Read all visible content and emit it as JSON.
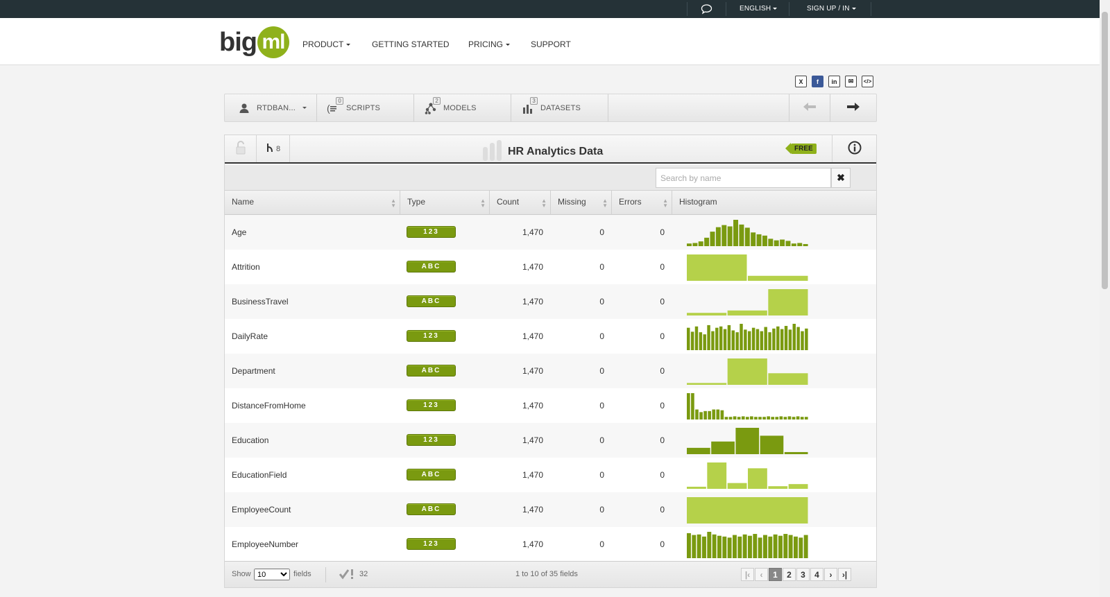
{
  "topbar": {
    "language": "ENGLISH",
    "signup": "SIGN UP / IN"
  },
  "logo": {
    "part1": "big",
    "part2": "ml"
  },
  "nav": {
    "product": "PRODUCT",
    "getting_started": "GETTING STARTED",
    "pricing": "PRICING",
    "support": "SUPPORT"
  },
  "social": [
    "X",
    "f",
    "in",
    "✉",
    "</>"
  ],
  "toolbar": {
    "user": "RTDBAN...",
    "scripts": "SCRIPTS",
    "scripts_count": "0",
    "models": "MODELS",
    "models_count": "2",
    "datasets": "DATASETS",
    "datasets_count": "3"
  },
  "dataset": {
    "title": "HR Analytics Data",
    "branch_count": "8",
    "free_label": "FREE"
  },
  "search": {
    "placeholder": "Search by name"
  },
  "columns": {
    "name": "Name",
    "type": "Type",
    "count": "Count",
    "missing": "Missing",
    "errors": "Errors",
    "histogram": "Histogram"
  },
  "rows": [
    {
      "name": "Age",
      "type": "123",
      "count": "1,470",
      "missing": "0",
      "errors": "0",
      "hist": [
        0.1,
        0.12,
        0.18,
        0.32,
        0.55,
        0.72,
        0.8,
        0.75,
        1.0,
        0.82,
        0.7,
        0.52,
        0.45,
        0.4,
        0.28,
        0.22,
        0.25,
        0.2,
        0.1,
        0.12,
        0.08
      ],
      "style": "dark"
    },
    {
      "name": "Attrition",
      "type": "ABC",
      "count": "1,470",
      "missing": "0",
      "errors": "0",
      "hist": [
        1.0,
        0.19
      ],
      "style": "light"
    },
    {
      "name": "BusinessTravel",
      "type": "ABC",
      "count": "1,470",
      "missing": "0",
      "errors": "0",
      "hist": [
        0.1,
        0.19,
        1.0
      ],
      "style": "light"
    },
    {
      "name": "DailyRate",
      "type": "123",
      "count": "1,470",
      "missing": "0",
      "errors": "0",
      "hist": [
        0.85,
        0.7,
        0.9,
        0.68,
        0.6,
        0.95,
        0.72,
        0.85,
        0.9,
        0.8,
        0.95,
        0.75,
        0.68,
        1.0,
        0.78,
        0.72,
        0.85,
        0.8,
        0.72,
        0.88,
        0.68,
        0.82,
        0.9,
        0.8,
        0.92,
        0.78,
        1.0,
        0.88,
        0.72,
        0.82
      ],
      "style": "dark"
    },
    {
      "name": "Department",
      "type": "ABC",
      "count": "1,470",
      "missing": "0",
      "errors": "0",
      "hist": [
        0.07,
        1.0,
        0.44
      ],
      "style": "light"
    },
    {
      "name": "DistanceFromHome",
      "type": "123",
      "count": "1,470",
      "missing": "0",
      "errors": "0",
      "hist": [
        1.0,
        1.0,
        0.38,
        0.28,
        0.32,
        0.32,
        0.38,
        0.38,
        0.35,
        0.1,
        0.1,
        0.12,
        0.1,
        0.12,
        0.1,
        0.12,
        0.1,
        0.1,
        0.1,
        0.12,
        0.1,
        0.1,
        0.12,
        0.1,
        0.12,
        0.1,
        0.12,
        0.1,
        0.1
      ],
      "style": "dark"
    },
    {
      "name": "Education",
      "type": "123",
      "count": "1,470",
      "missing": "0",
      "errors": "0",
      "hist": [
        0.24,
        0.48,
        1.0,
        0.7,
        0.08
      ],
      "style": "dark"
    },
    {
      "name": "EducationField",
      "type": "ABC",
      "count": "1,470",
      "missing": "0",
      "errors": "0",
      "hist": [
        0.08,
        1.0,
        0.22,
        0.78,
        0.1,
        0.18
      ],
      "style": "light"
    },
    {
      "name": "EmployeeCount",
      "type": "ABC",
      "count": "1,470",
      "missing": "0",
      "errors": "0",
      "hist": [
        1.0
      ],
      "style": "light"
    },
    {
      "name": "EmployeeNumber",
      "type": "123",
      "count": "1,470",
      "missing": "0",
      "errors": "0",
      "hist": [
        0.95,
        0.88,
        0.9,
        0.82,
        1.0,
        0.9,
        0.85,
        0.82,
        0.78,
        0.88,
        0.82,
        0.9,
        0.85,
        0.92,
        0.78,
        0.88,
        0.82,
        0.9,
        0.85,
        0.92,
        0.88,
        0.82,
        0.78,
        0.88
      ],
      "style": "dark"
    }
  ],
  "footer": {
    "show": "Show",
    "page_size": "10",
    "fields": "fields",
    "valid_count": "32",
    "range": "1 to 10 of 35 fields",
    "pages": [
      "1",
      "2",
      "3",
      "4"
    ]
  },
  "colors": {
    "histogram_dark": "#7a9a10",
    "histogram_light": "#b5d14a",
    "accent": "#8fb11b",
    "topbar": "#253237"
  }
}
